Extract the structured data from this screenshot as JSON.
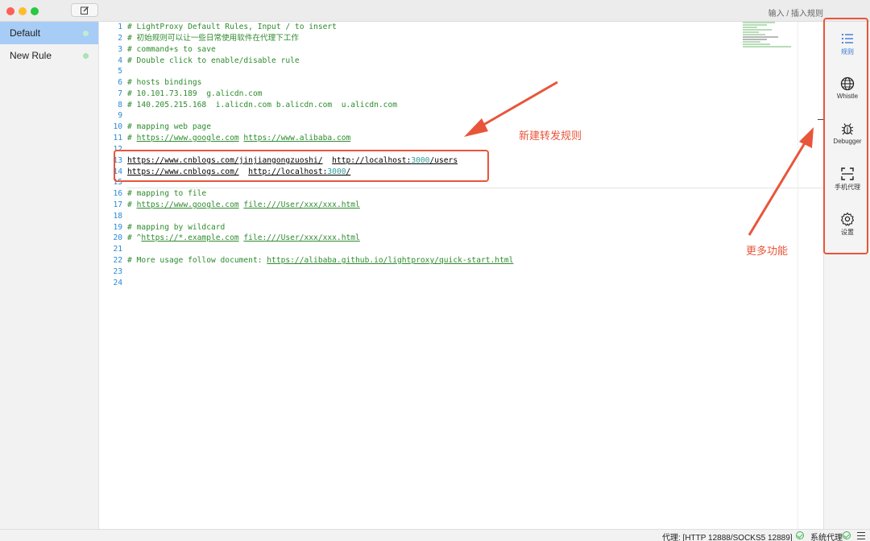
{
  "titlebar": {
    "hint": "输入 / 插入规则"
  },
  "sidebar": {
    "items": [
      {
        "label": "Default",
        "active": true
      },
      {
        "label": "New Rule",
        "active": false
      }
    ]
  },
  "editor": {
    "lines": [
      {
        "n": "1",
        "text": "# LightProxy Default Rules, Input / to insert"
      },
      {
        "n": "2",
        "text": "# 初始规则可以让一些日常使用软件在代理下工作"
      },
      {
        "n": "3",
        "text": "# command+s to save"
      },
      {
        "n": "4",
        "text": "# Double click to enable/disable rule"
      },
      {
        "n": "5",
        "text": ""
      },
      {
        "n": "6",
        "text": "# hosts bindings"
      },
      {
        "n": "7",
        "text": "# 10.101.73.189  g.alicdn.com"
      },
      {
        "n": "8",
        "text": "# 140.205.215.168  i.alicdn.com b.alicdn.com  u.alicdn.com"
      },
      {
        "n": "9",
        "text": ""
      },
      {
        "n": "10",
        "text": "# mapping web page"
      },
      {
        "n": "11",
        "prefix": "# ",
        "url1": "https://www.google.com",
        "url2": "https://www.alibaba.com"
      },
      {
        "n": "12",
        "text": ""
      },
      {
        "n": "13",
        "url1": "https://www.cnblogs.com/jinjiangongzuoshi/",
        "url2a": "http://localhost:",
        "port": "3000",
        "url2b": "/users"
      },
      {
        "n": "14",
        "url1": "https://www.cnblogs.com/",
        "url2a": "http://localhost:",
        "port": "3000",
        "url2b": "/"
      },
      {
        "n": "15",
        "text": ""
      },
      {
        "n": "16",
        "text": "# mapping to file"
      },
      {
        "n": "17",
        "prefix": "# ",
        "url1": "https://www.google.com",
        "url2": "file:///User/xxx/xxx.html"
      },
      {
        "n": "18",
        "text": ""
      },
      {
        "n": "19",
        "text": "# mapping by wildcard"
      },
      {
        "n": "20",
        "prefix": "# ^",
        "url1": "https://*.example.com",
        "url2": "file:///User/xxx/xxx.html"
      },
      {
        "n": "21",
        "text": ""
      },
      {
        "n": "22",
        "prefix": "# More usage follow document: ",
        "url1": "https://alibaba.github.io/lightproxy/quick-start.html"
      },
      {
        "n": "23",
        "text": ""
      },
      {
        "n": "24",
        "text": ""
      }
    ]
  },
  "right_panel": {
    "items": [
      {
        "label": "规则",
        "icon": "list-icon",
        "active": true
      },
      {
        "label": "Whistle",
        "icon": "globe-icon",
        "active": false
      },
      {
        "label": "Debugger",
        "icon": "bug-icon",
        "active": false
      },
      {
        "label": "手机代理",
        "icon": "scan-icon",
        "active": false
      },
      {
        "label": "设置",
        "icon": "gear-icon",
        "active": false
      }
    ]
  },
  "annotations": {
    "new_rule": "新建转发规则",
    "more_features": "更多功能"
  },
  "statusbar": {
    "proxy": "代理: [HTTP 12888/SOCKS5 12889]",
    "system_proxy": "系统代理"
  },
  "colors": {
    "accent": "#a7ccf6",
    "annotation": "#e8553a",
    "comment": "#2e8b2e",
    "line_number": "#2b8ad6"
  }
}
